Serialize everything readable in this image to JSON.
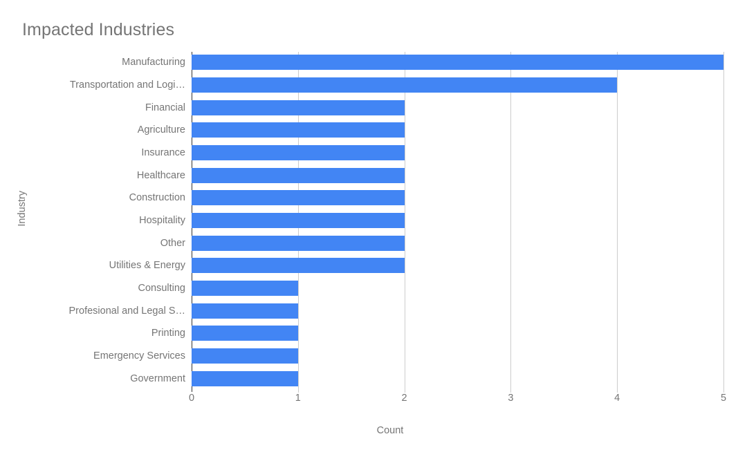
{
  "chart_data": {
    "type": "bar",
    "orientation": "horizontal",
    "title": "Impacted Industries",
    "xlabel": "Count",
    "ylabel": "Industry",
    "xlim": [
      0,
      5
    ],
    "xticks": [
      "0",
      "1",
      "2",
      "3",
      "4",
      "5"
    ],
    "grid": true,
    "legend": false,
    "bar_color": "#4285f4",
    "title_color": "#757575",
    "label_color": "#757575",
    "gridline_color": "#cccccc",
    "axis_color": "#333333",
    "background": "#ffffff",
    "categories": [
      "Manufacturing",
      "Transportation and Logi…",
      "Financial",
      "Agriculture",
      "Insurance",
      "Healthcare",
      "Construction",
      "Hospitality",
      "Other",
      "Utilities & Energy",
      "Consulting",
      "Profesional and Legal S…",
      "Printing",
      "Emergency Services",
      "Government"
    ],
    "values": [
      5,
      4,
      2,
      2,
      2,
      2,
      2,
      2,
      2,
      2,
      1,
      1,
      1,
      1,
      1
    ]
  }
}
